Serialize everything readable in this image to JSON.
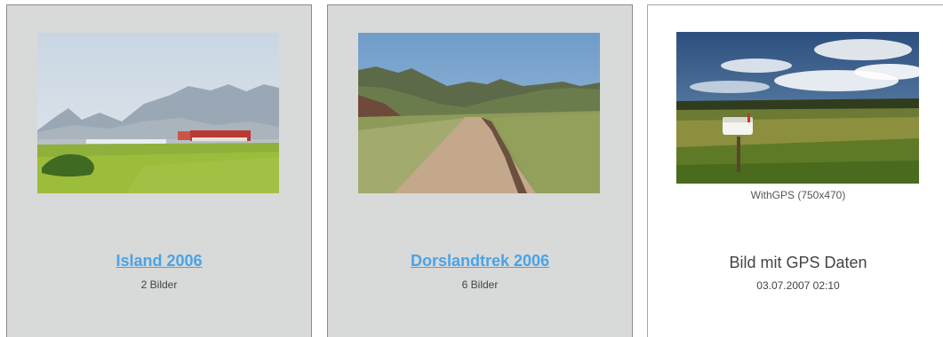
{
  "albums": [
    {
      "title": "Island 2006",
      "count": "2 Bilder",
      "thumbnail": "landscape-iceland-photo"
    },
    {
      "title": "Dorslandtrek 2006",
      "count": "6 Bilder",
      "thumbnail": "dirt-road-photo"
    }
  ],
  "photo": {
    "caption": "WithGPS (750x470)",
    "title": "Bild mit GPS Daten",
    "date": "03.07.2007 02:10",
    "thumbnail": "mailbox-field-photo"
  },
  "colors": {
    "album_bg": "#d8d9d9",
    "link": "#4aa3e6",
    "text": "#444444"
  }
}
